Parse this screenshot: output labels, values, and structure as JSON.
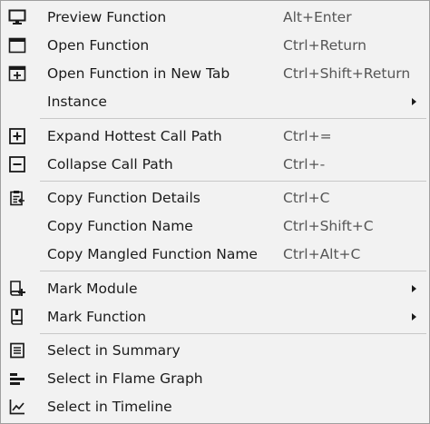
{
  "menu": {
    "items": [
      {
        "label": "Preview Function",
        "shortcut": "Alt+Enter",
        "icon": "monitor-icon"
      },
      {
        "label": "Open Function",
        "shortcut": "Ctrl+Return",
        "icon": "window-icon"
      },
      {
        "label": "Open Function in New Tab",
        "shortcut": "Ctrl+Shift+Return",
        "icon": "new-tab-icon"
      },
      {
        "label": "Instance",
        "shortcut": "",
        "icon": "",
        "submenu": true
      },
      {
        "label": "Expand Hottest Call Path",
        "shortcut": "Ctrl+=",
        "icon": "plus-box-icon"
      },
      {
        "label": "Collapse Call Path",
        "shortcut": "Ctrl+-",
        "icon": "minus-box-icon"
      },
      {
        "label": "Copy Function Details",
        "shortcut": "Ctrl+C",
        "icon": "clipboard-icon"
      },
      {
        "label": "Copy Function Name",
        "shortcut": "Ctrl+Shift+C",
        "icon": ""
      },
      {
        "label": "Copy Mangled Function Name",
        "shortcut": "Ctrl+Alt+C",
        "icon": ""
      },
      {
        "label": "Mark Module",
        "shortcut": "",
        "icon": "bookmark-add-icon",
        "submenu": true
      },
      {
        "label": "Mark Function",
        "shortcut": "",
        "icon": "bookmark-icon",
        "submenu": true
      },
      {
        "label": "Select in Summary",
        "shortcut": "",
        "icon": "summary-list-icon"
      },
      {
        "label": "Select in Flame Graph",
        "shortcut": "",
        "icon": "flame-graph-icon"
      },
      {
        "label": "Select in Timeline",
        "shortcut": "",
        "icon": "timeline-chart-icon"
      }
    ]
  }
}
